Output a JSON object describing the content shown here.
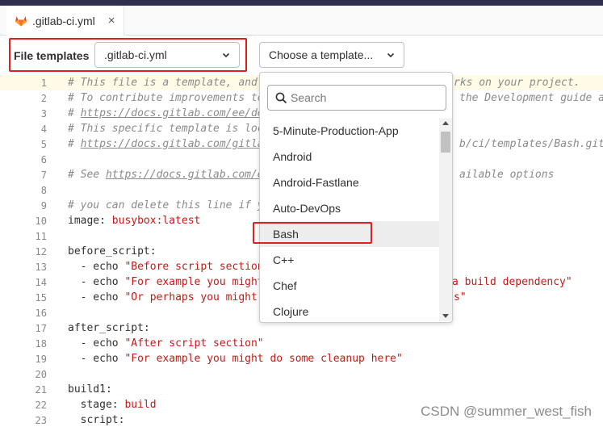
{
  "tab": {
    "filename": ".gitlab-ci.yml",
    "close": "×",
    "icon": "gitlab-fox-icon"
  },
  "toolbar": {
    "label": "File templates",
    "type_select": ".gitlab-ci.yml",
    "template_select": "Choose a template..."
  },
  "dropdown": {
    "search_placeholder": "Search",
    "items": [
      "5-Minute-Production-App",
      "Android",
      "Android-Fastlane",
      "Auto-DevOps",
      "Bash",
      "C++",
      "Chef",
      "Clojure"
    ],
    "hovered": "Bash"
  },
  "editor": {
    "lines": [
      {
        "n": "1",
        "a": "# This file is a template, and",
        "b": "rks on your project."
      },
      {
        "n": "2",
        "a": "# To contribute improvements to",
        "b": "the Development guide a"
      },
      {
        "n": "3",
        "a": "# ",
        "link": "https://docs.gitlab.com/ee/de",
        "b": ""
      },
      {
        "n": "4",
        "a": "# This specific template is loc",
        "b": ""
      },
      {
        "n": "5",
        "a": "# ",
        "link": "https://docs.gitlab.com/gitlab-org",
        "b": "b/ci/templates/Bash.gitl"
      },
      {
        "n": "6",
        "a": "",
        "b": ""
      },
      {
        "n": "7",
        "a": "# See ",
        "link": "https://docs.gitlab.com/e",
        "b": "ailable options"
      },
      {
        "n": "8",
        "a": "",
        "b": ""
      },
      {
        "n": "9",
        "a": "# you can delete this line if y",
        "b": ""
      },
      {
        "n": "10",
        "key": "image:",
        "str": " busybox:latest"
      },
      {
        "n": "11"
      },
      {
        "n": "12",
        "key": "before_script:"
      },
      {
        "n": "13",
        "key": "  - echo",
        "str": " \"Before script section"
      },
      {
        "n": "14",
        "key": "  - echo",
        "str": " \"For example you might",
        "tail": "a build dependency\""
      },
      {
        "n": "15",
        "key": "  - echo",
        "str": " \"Or perhaps you might",
        "tail": "s\""
      },
      {
        "n": "16"
      },
      {
        "n": "17",
        "key": "after_script:"
      },
      {
        "n": "18",
        "key": "  - echo",
        "str": " \"After script section\""
      },
      {
        "n": "19",
        "key": "  - echo",
        "str": " \"For example you might do some cleanup here\""
      },
      {
        "n": "20"
      },
      {
        "n": "21",
        "key": "build1:"
      },
      {
        "n": "22",
        "key": "  stage:",
        "str": " build"
      },
      {
        "n": "23",
        "key": "  script:"
      }
    ]
  },
  "watermark": "CSDN @summer_west_fish"
}
